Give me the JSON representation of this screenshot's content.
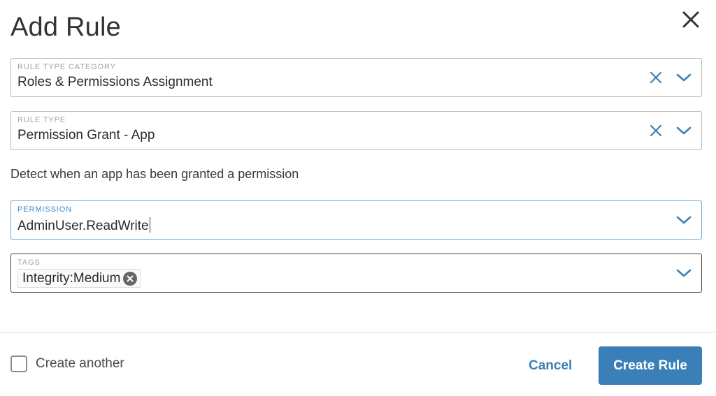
{
  "dialog": {
    "title": "Add Rule",
    "close_icon": "close-icon"
  },
  "fields": {
    "rule_type_category": {
      "label": "RULE TYPE CATEGORY",
      "value": "Roles & Permissions Assignment",
      "clear_icon": "clear-icon",
      "dropdown_icon": "chevron-down-icon"
    },
    "rule_type": {
      "label": "RULE TYPE",
      "value": "Permission Grant - App",
      "clear_icon": "clear-icon",
      "dropdown_icon": "chevron-down-icon"
    },
    "permission": {
      "label": "PERMISSION",
      "value": "AdminUser.ReadWrite",
      "state": "focused",
      "dropdown_icon": "chevron-down-icon"
    },
    "tags": {
      "label": "TAGS",
      "chips": [
        {
          "label": "Integrity:Medium",
          "remove_icon": "remove-tag-icon"
        }
      ],
      "dropdown_icon": "chevron-down-icon"
    }
  },
  "description": "Detect when an app has been granted a permission",
  "footer": {
    "create_another": {
      "label": "Create another",
      "checked": false
    },
    "cancel_label": "Cancel",
    "create_label": "Create Rule"
  },
  "colors": {
    "accent": "#3a7fb8",
    "icon_blue": "#3b82b5",
    "focus_border": "#6aaed6",
    "text": "#333333"
  }
}
